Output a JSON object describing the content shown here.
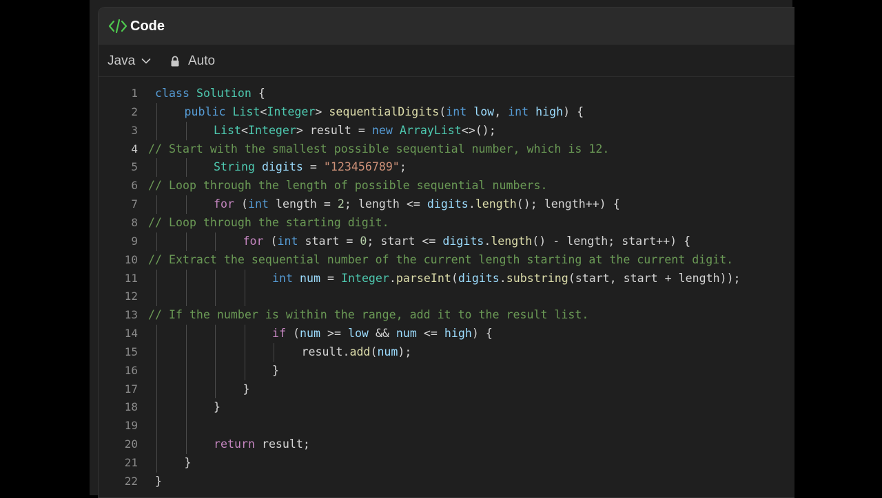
{
  "header": {
    "title": "Code",
    "icon": "code-brackets-icon",
    "icon_color": "#4ec94e"
  },
  "toolbar": {
    "language": "Java",
    "language_icon": "chevron-down-icon",
    "mode_icon": "lock-icon",
    "mode": "Auto"
  },
  "editor": {
    "active_line": 4,
    "colors": {
      "keyword": "#569cd6",
      "control": "#c586c0",
      "type": "#4ec9b0",
      "function": "#dcdcaa",
      "variable": "#9cdcfe",
      "string": "#ce9178",
      "number": "#b5cea8",
      "comment": "#6a9955"
    },
    "lines": [
      {
        "n": "1",
        "text": "class Solution {"
      },
      {
        "n": "2",
        "text": "public List<Integer> sequentialDigits(int low, int high) {"
      },
      {
        "n": "3",
        "text": "List<Integer> result = new ArrayList<>();"
      },
      {
        "n": "4",
        "text": "// Start with the smallest possible sequential number, which is 12."
      },
      {
        "n": "5",
        "text": "String digits = \"123456789\";"
      },
      {
        "n": "6",
        "text": "// Loop through the length of possible sequential numbers."
      },
      {
        "n": "7",
        "text": "for (int length = 2; length <= digits.length(); length++) {"
      },
      {
        "n": "8",
        "text": "// Loop through the starting digit."
      },
      {
        "n": "9",
        "text": "for (int start = 0; start <= digits.length() - length; start++) {"
      },
      {
        "n": "10",
        "text": "// Extract the sequential number of the current length starting at the current digit."
      },
      {
        "n": "11",
        "text": "int num = Integer.parseInt(digits.substring(start, start + length));"
      },
      {
        "n": "12",
        "text": ""
      },
      {
        "n": "13",
        "text": "// If the number is within the range, add it to the result list."
      },
      {
        "n": "14",
        "text": "if (num >= low && num <= high) {"
      },
      {
        "n": "15",
        "text": "result.add(num);"
      },
      {
        "n": "16",
        "text": "}"
      },
      {
        "n": "17",
        "text": "}"
      },
      {
        "n": "18",
        "text": "}"
      },
      {
        "n": "19",
        "text": ""
      },
      {
        "n": "20",
        "text": "return result;"
      },
      {
        "n": "21",
        "text": "}"
      },
      {
        "n": "22",
        "text": "}"
      }
    ]
  }
}
